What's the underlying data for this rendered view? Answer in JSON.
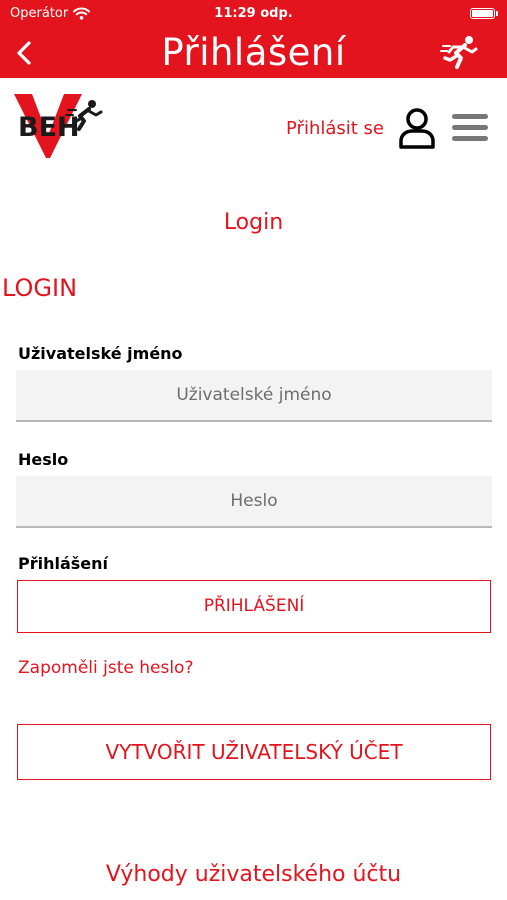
{
  "status_bar": {
    "carrier": "Operátor",
    "time": "11:29 odp."
  },
  "nav": {
    "title": "Přihlášení"
  },
  "header": {
    "logo_text": "BEH",
    "signin_label": "Přihlásit se"
  },
  "page": {
    "title": "Login",
    "heading": "LOGIN"
  },
  "form": {
    "username": {
      "label": "Uživatelské jméno",
      "placeholder": "Uživatelské jméno",
      "value": ""
    },
    "password": {
      "label": "Heslo",
      "placeholder": "Heslo",
      "value": ""
    },
    "submit_section_label": "Přihlášení",
    "submit_label": "PŘIHLÁŠENÍ",
    "forgot_link": "Zapoměli jste heslo?",
    "create_account_label": "VYTVOŘIT UŽIVATELSKÝ ÚČET"
  },
  "footer": {
    "benefits_link": "Výhody uživatelského účtu"
  },
  "colors": {
    "brand_red": "#e3141d",
    "input_bg": "#f3f3f3",
    "menu_gray": "#777777"
  },
  "icons": {
    "back": "chevron-left-icon",
    "runner": "runner-icon",
    "user": "user-icon",
    "menu": "hamburger-menu-icon",
    "wifi": "wifi-icon",
    "battery": "battery-icon"
  }
}
